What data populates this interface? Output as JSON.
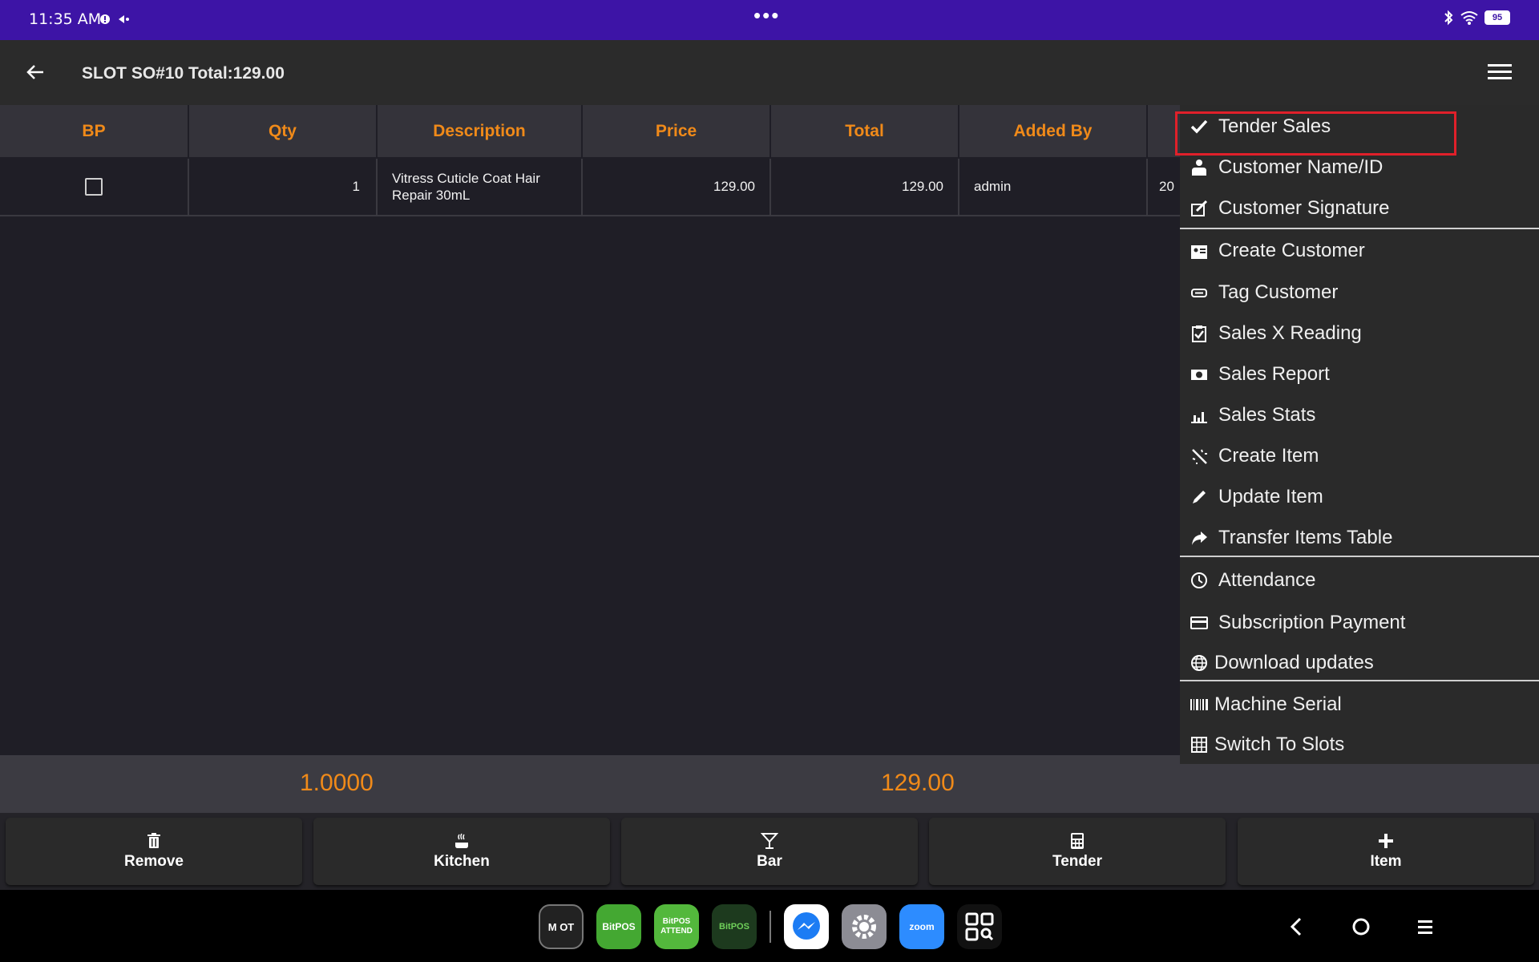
{
  "status_bar": {
    "time": "11:35 AM",
    "battery": "95",
    "dots": "•••"
  },
  "app_bar": {
    "title": "SLOT SO#10 Total:129.00"
  },
  "table": {
    "columns": [
      "BP",
      "Qty",
      "Description",
      "Price",
      "Total",
      "Added By",
      ""
    ],
    "rows": [
      {
        "qty": "1",
        "description": "Vitress Cuticle Coat Hair Repair 30mL",
        "price": "129.00",
        "total": "129.00",
        "added_by": "admin",
        "extra": "20"
      }
    ]
  },
  "totals": {
    "qty": "1.0000",
    "amount": "129.00"
  },
  "actions": [
    "Remove",
    "Kitchen",
    "Bar",
    "Tender",
    "Item"
  ],
  "dock": {
    "apps": [
      "M OT",
      "BitPOS",
      "BitPOS ATTEND",
      "BitPOS",
      "Messenger",
      "Settings",
      "zoom",
      "Apps"
    ]
  },
  "menu": {
    "items": [
      {
        "label": "Tender Sales",
        "icon": "check-icon"
      },
      {
        "label": "Customer Name/ID",
        "icon": "person-icon"
      },
      {
        "label": "Customer Signature",
        "icon": "signature-icon"
      },
      {
        "label": "Create Customer",
        "icon": "create-customer-icon"
      },
      {
        "label": "Tag Customer",
        "icon": "tag-icon"
      },
      {
        "label": "Sales X Reading",
        "icon": "clipboard-check-icon"
      },
      {
        "label": "Sales Report",
        "icon": "money-icon"
      },
      {
        "label": "Sales Stats",
        "icon": "chart-icon"
      },
      {
        "label": "Create Item",
        "icon": "magic-wand-icon"
      },
      {
        "label": "Update Item",
        "icon": "pencil-icon"
      },
      {
        "label": "Transfer Items Table",
        "icon": "share-icon"
      },
      {
        "label": "Attendance",
        "icon": "clock-icon"
      },
      {
        "label": "Subscription Payment",
        "icon": "credit-card-icon"
      },
      {
        "label": "Download updates",
        "icon": "globe-icon"
      },
      {
        "label": "Machine Serial",
        "icon": "barcode-icon"
      },
      {
        "label": "Switch To Slots",
        "icon": "grid-icon"
      }
    ]
  },
  "colors": {
    "accent": "#f08a19",
    "status_bar": "#3d14a6",
    "highlight": "#e0202a"
  }
}
